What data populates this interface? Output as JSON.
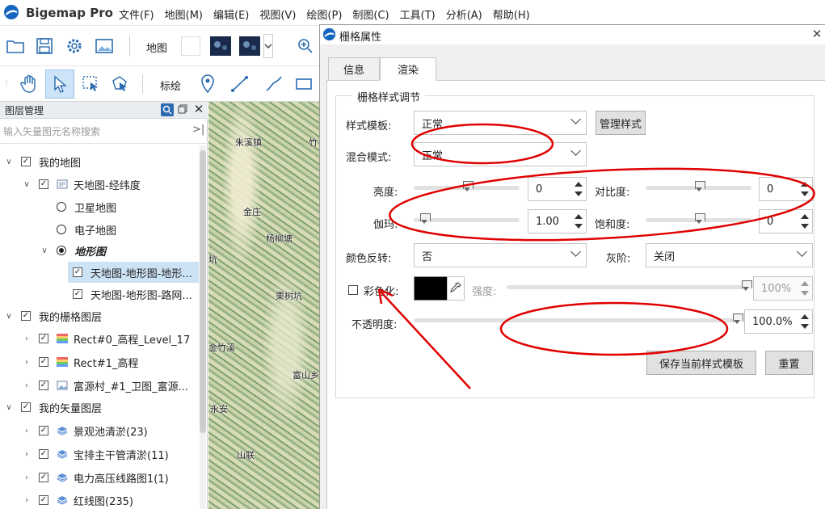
{
  "app": {
    "title": "Bigemap Pro",
    "menu": [
      "文件(F)",
      "地图(M)",
      "编辑(E)",
      "视图(V)",
      "绘图(P)",
      "制图(C)",
      "工具(T)",
      "分析(A)",
      "帮助(H)"
    ]
  },
  "toolbar": {
    "map_label": "地图",
    "draw_label": "标绘"
  },
  "layer_panel": {
    "title": "图层管理",
    "search_placeholder": "输入矢量图元名称搜索",
    "tree": [
      {
        "label": "我的地图",
        "kind": "group",
        "expanded": true
      },
      {
        "label": "天地图-经纬度",
        "kind": "map",
        "expanded": true
      },
      {
        "label": "卫星地图",
        "kind": "radio",
        "checked": false
      },
      {
        "label": "电子地图",
        "kind": "radio",
        "checked": false
      },
      {
        "label": "地形图",
        "kind": "radio",
        "checked": true
      },
      {
        "label": "天地图-地形图-地形...",
        "kind": "layer",
        "selected": true
      },
      {
        "label": "天地图-地形图-路网...",
        "kind": "layer"
      },
      {
        "label": "我的栅格图层",
        "kind": "group"
      },
      {
        "label": "Rect#0_高程_Level_17",
        "kind": "raster"
      },
      {
        "label": "Rect#1_高程",
        "kind": "raster"
      },
      {
        "label": "富源村_#1_卫图_富源...",
        "kind": "image"
      },
      {
        "label": "我的矢量图层",
        "kind": "group"
      },
      {
        "label": "景观池清淤(23)",
        "kind": "vector"
      },
      {
        "label": "宝排主干管清淤(11)",
        "kind": "vector"
      },
      {
        "label": "电力高压线路图1(1)",
        "kind": "vector"
      },
      {
        "label": "红线图(235)",
        "kind": "vector"
      }
    ]
  },
  "map": {
    "places": [
      "朱溪镇",
      "竹",
      "金庄",
      "杨柳塘",
      "坑",
      "栗树坑",
      "金竹溪",
      "富山乡",
      "永安",
      "山联"
    ]
  },
  "dialog": {
    "title": "栅格属性",
    "tabs": [
      "信息",
      "渲染"
    ],
    "active_tab": "渲染",
    "group_title": "栅格样式调节",
    "style_template_label": "样式模板:",
    "style_template_value": "正常",
    "manage_style_button": "管理样式",
    "blend_mode_label": "混合模式:",
    "blend_mode_value": "正常",
    "brightness_label": "亮度:",
    "brightness_value": "0",
    "brightness_level": 0.5,
    "contrast_label": "对比度:",
    "contrast_value": "0",
    "contrast_level": 0.5,
    "gamma_label": "伽玛:",
    "gamma_value": "1.00",
    "gamma_level": 0.1,
    "saturation_label": "饱和度:",
    "saturation_value": "0",
    "saturation_level": 0.5,
    "invert_label": "颜色反转:",
    "invert_value": "否",
    "grayscale_label": "灰阶:",
    "grayscale_value": "关闭",
    "colorize_label": "彩色化:",
    "colorize_checked": false,
    "colorize_color": "#000000",
    "intensity_label": "强度:",
    "intensity_value": "100%",
    "intensity_level": 1.0,
    "opacity_label": "不透明度:",
    "opacity_value": "100.0%",
    "opacity_level": 1.0,
    "save_template_button": "保存当前样式模板",
    "reset_button": "重置"
  },
  "colors": {
    "accent": "#1565c0",
    "annotation_red": "#e00000",
    "selection": "#cce2f5"
  }
}
